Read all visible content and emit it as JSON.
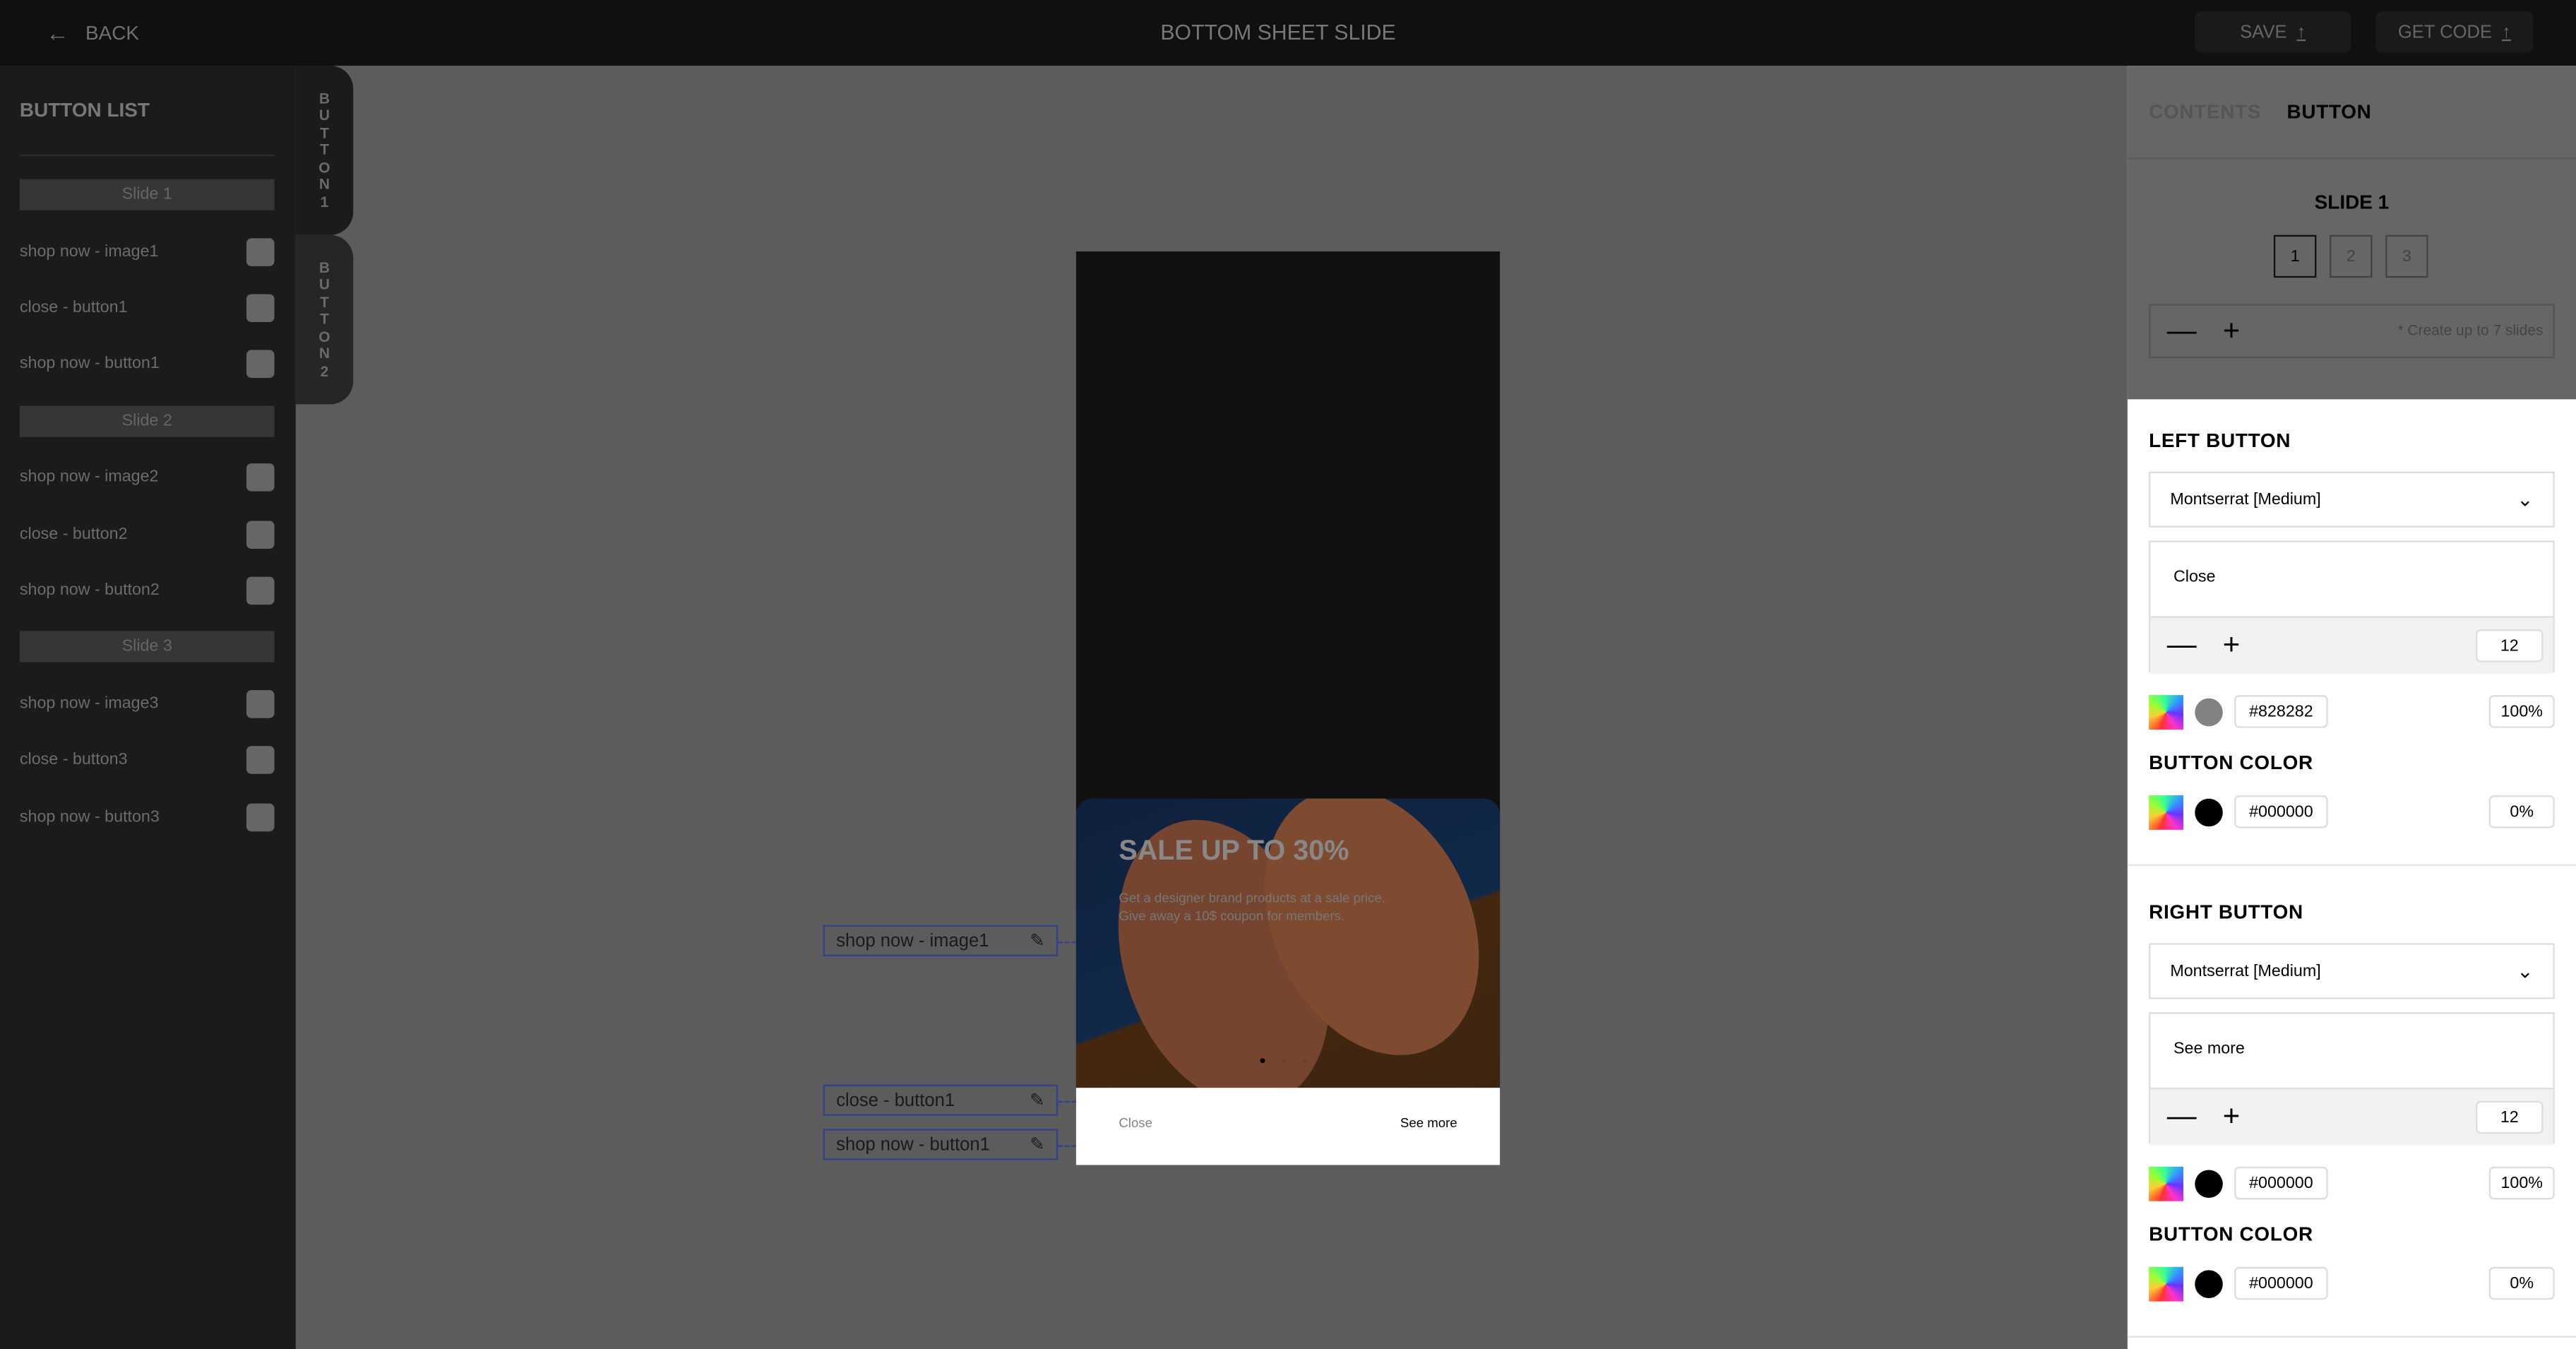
{
  "header": {
    "back_label": "BACK",
    "title": "BOTTOM SHEET SLIDE",
    "save_label": "SAVE",
    "get_code_label": "GET CODE"
  },
  "sidebar": {
    "title": "BUTTON LIST",
    "tabs": [
      "BUTTON1",
      "BUTTON2"
    ],
    "groups": [
      {
        "slide": "Slide 1",
        "items": [
          "shop now - image1",
          "close - button1",
          "shop now - button1"
        ]
      },
      {
        "slide": "Slide 2",
        "items": [
          "shop now - image2",
          "close - button2",
          "shop now - button2"
        ]
      },
      {
        "slide": "Slide 3",
        "items": [
          "shop now - image3",
          "close - button3",
          "shop now - button3"
        ]
      }
    ]
  },
  "canvas": {
    "labels": [
      "shop now - image1",
      "close - button1",
      "shop now - button1"
    ],
    "preview": {
      "headline": "SALE UP TO 30%",
      "desc_line1": "Get a designer brand products at a sale price.",
      "desc_line2": "Give away a 10$ coupon for members.",
      "left_button": "Close",
      "right_button": "See more",
      "active_dot": 1,
      "dot_count": 3
    }
  },
  "panel": {
    "tabs": [
      "CONTENTS",
      "BUTTON"
    ],
    "active_tab": "BUTTON",
    "slide_title": "SLIDE 1",
    "slides": [
      "1",
      "2",
      "3"
    ],
    "active_slide": "1",
    "slide_note": "* Create up to 7 slides",
    "left": {
      "title": "LEFT BUTTON",
      "font": "Montserrat [Medium]",
      "text": "Close",
      "size": "12",
      "text_color": "#828282",
      "text_opacity": "100%",
      "color_title": "BUTTON COLOR",
      "button_color": "#000000",
      "button_opacity": "0%"
    },
    "right": {
      "title": "RIGHT BUTTON",
      "font": "Montserrat [Medium]",
      "text": "See more",
      "size": "12",
      "text_color": "#000000",
      "text_opacity": "100%",
      "color_title": "BUTTON COLOR",
      "button_color": "#000000",
      "button_opacity": "0%"
    }
  }
}
